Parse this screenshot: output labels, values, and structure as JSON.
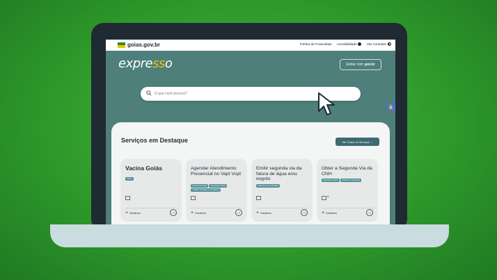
{
  "topbar": {
    "site": "goias.gov.br",
    "links": [
      "Política de Privacidade",
      "Acessibilidade",
      "Alto Contraste"
    ]
  },
  "hero": {
    "brand_prefix": "expre",
    "brand_mid": "ss",
    "brand_suffix": "o",
    "login_prefix": "Entrar com",
    "login_brand": "gov.br",
    "search_placeholder": "O que você procura?"
  },
  "services": {
    "title": "Serviços em Destaque",
    "see_all": "Ver Todos os Serviços",
    "details_label": "Detalhes",
    "cards": [
      {
        "title": "Vacina Goiás",
        "tags": [
          "Saúde"
        ],
        "extra": ""
      },
      {
        "title": "Agendar Atendimento Presencial no Vapt Vupt",
        "tags": [
          "Assistência Social",
          "Segurança Pública",
          "Trabalho, Emprego e Previdência"
        ],
        "extra": ""
      },
      {
        "title": "Emitir segunda via da fatura de água e/ou esgoto",
        "tags": [
          "Infraestrutura e Habitação"
        ],
        "extra": ""
      },
      {
        "title": "Obter a Segunda Via da CNH",
        "tags": [
          "Segurança Pública",
          "Trânsito e Transportes"
        ],
        "extra": "$"
      }
    ]
  },
  "colors": {
    "background_green": "#3aa733",
    "hero_teal": "#4e7f7a",
    "accent_yellow": "#f2c200",
    "tag_teal": "#4f8f95"
  }
}
